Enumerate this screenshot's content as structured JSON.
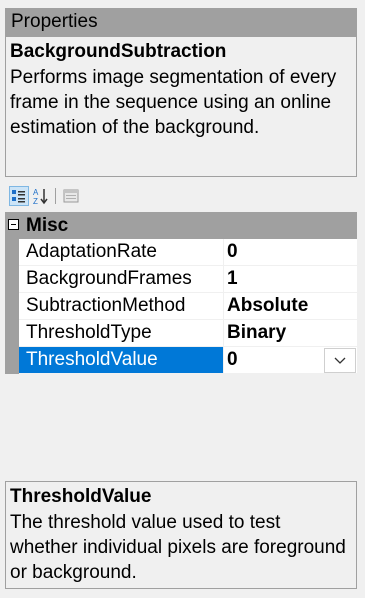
{
  "panel": {
    "title": "Properties"
  },
  "header": {
    "object_name": "BackgroundSubtraction",
    "description": "Performs image segmentation of every frame in the sequence using an online estimation of the background."
  },
  "toolbar": {
    "buttons": [
      {
        "icon": "categorized-icon",
        "active": true
      },
      {
        "icon": "alphabetical-sort-icon",
        "active": false
      },
      {
        "icon": "property-pages-icon",
        "active": false
      }
    ]
  },
  "grid": {
    "category": "Misc",
    "rows": [
      {
        "name": "AdaptationRate",
        "value": "0"
      },
      {
        "name": "BackgroundFrames",
        "value": "1"
      },
      {
        "name": "SubtractionMethod",
        "value": "Absolute"
      },
      {
        "name": "ThresholdType",
        "value": "Binary"
      },
      {
        "name": "ThresholdValue",
        "value": "0"
      }
    ]
  },
  "help": {
    "title": "ThresholdValue",
    "description": "The threshold value used to test whether individual pixels are foreground or background."
  },
  "colors": {
    "selection": "#0078d7",
    "header_gray": "#a0a0a0",
    "background": "#f0f0f0"
  }
}
